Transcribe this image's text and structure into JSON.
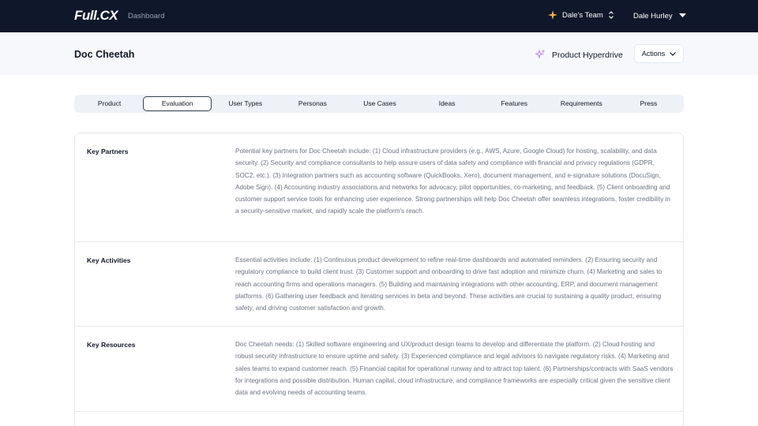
{
  "topbar": {
    "logo": "Full.CX",
    "nav_dashboard": "Dashboard",
    "team_name": "Dale's Team",
    "user_name": "Dale Hurley",
    "team_icon": "sparkle-icon",
    "accent": "#f5b942"
  },
  "header": {
    "title": "Doc Cheetah",
    "hyperdrive_label": "Product Hyperdrive",
    "hyperdrive_icon": "sparkles-icon",
    "hyperdrive_color": "#c084fc",
    "actions_label": "Actions"
  },
  "tabs": [
    {
      "label": "Product",
      "active": false
    },
    {
      "label": "Evaluation",
      "active": true
    },
    {
      "label": "User Types",
      "active": false
    },
    {
      "label": "Personas",
      "active": false
    },
    {
      "label": "Use Cases",
      "active": false
    },
    {
      "label": "Ideas",
      "active": false
    },
    {
      "label": "Features",
      "active": false
    },
    {
      "label": "Requirements",
      "active": false
    },
    {
      "label": "Press",
      "active": false
    }
  ],
  "rows": [
    {
      "label": "Key Partners",
      "text": "Potential key partners for Doc Cheetah include: (1) Cloud infrastructure providers (e.g., AWS, Azure, Google Cloud) for hosting, scalability, and data security. (2) Security and compliance consultants to help assure users of data safety and compliance with financial and privacy regulations (GDPR, SOC2, etc.). (3) Integration partners such as accounting software (QuickBooks, Xero), document management, and e-signature solutions (DocuSign, Adobe Sign). (4) Accounting industry associations and networks for advocacy, pilot opportunities, co-marketing, and feedback. (5) Client onboarding and customer support service tools for enhancing user experience. Strong partnerships will help Doc Cheetah offer seamless integrations, foster credibility in a security-sensitive market, and rapidly scale the platform's reach."
    },
    {
      "label": "Key Activities",
      "text": "Essential activities include: (1) Continuous product development to refine real-time dashboards and automated reminders. (2) Ensuring security and regulatory compliance to build client trust. (3) Customer support and onboarding to drive fast adoption and minimize churn. (4) Marketing and sales to reach accounting firms and operations managers. (5) Building and maintaining integrations with other accounting, ERP, and document management platforms. (6) Gathering user feedback and iterating services in beta and beyond. These activities are crucial to sustaining a quality product, ensuring safety, and driving customer satisfaction and growth."
    },
    {
      "label": "Key Resources",
      "text": "Doc Cheetah needs: (1) Skilled software engineering and UX/product design teams to develop and differentiate the platform. (2) Cloud hosting and robust security infrastructure to ensure uptime and safety. (3) Experienced compliance and legal advisors to navigate regulatory risks. (4) Marketing and sales teams to expand customer reach. (5) Financial capital for operational runway and to attract top talent. (6) Partnerships/contracts with SaaS vendors for integrations and possible distribution. Human capital, cloud infrastructure, and compliance frameworks are especially critical given the sensitive client data and evolving needs of accounting teams."
    }
  ]
}
